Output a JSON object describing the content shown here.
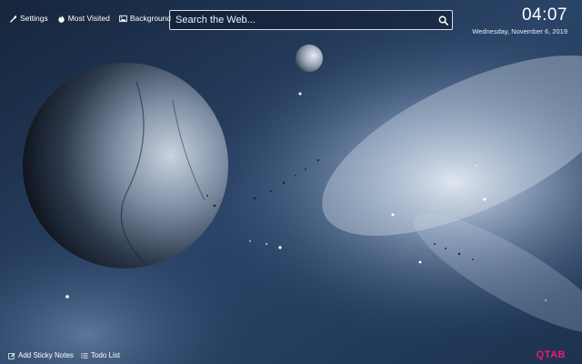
{
  "topbar": {
    "settings_label": "Settings",
    "most_visited_label": "Most Visited",
    "background_label": "Background"
  },
  "search": {
    "placeholder": "Search the Web..."
  },
  "clock": {
    "time": "04:07",
    "date": "Wednesday, November 6, 2019"
  },
  "bottombar": {
    "sticky_notes_label": "Add Sticky Notes",
    "todo_label": "Todo List"
  },
  "brand": {
    "logo_text": "QTAB",
    "color": "#f0186e"
  },
  "icons": [
    "wrench-icon",
    "fire-icon",
    "image-icon",
    "search-icon",
    "edit-icon",
    "list-icon"
  ]
}
